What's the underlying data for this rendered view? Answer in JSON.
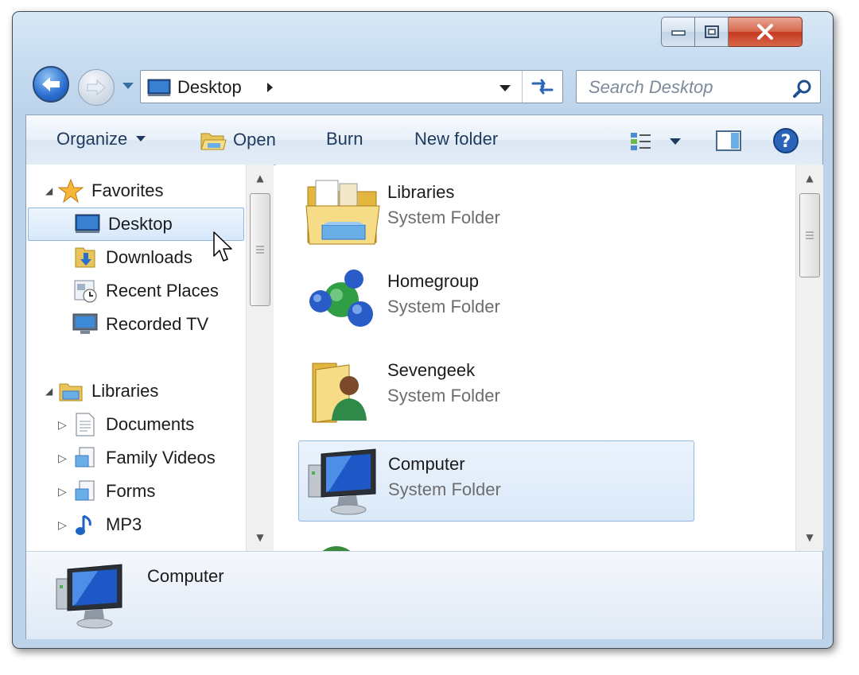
{
  "window": {
    "caption_buttons": [
      "minimize",
      "maximize",
      "close"
    ]
  },
  "address_bar": {
    "location": "Desktop"
  },
  "search": {
    "placeholder": "Search Desktop"
  },
  "toolbar": {
    "organize": "Organize",
    "open": "Open",
    "burn": "Burn",
    "new_folder": "New folder"
  },
  "navigation": {
    "favorites_header": "Favorites",
    "favorites": [
      {
        "label": "Desktop",
        "icon": "desktop-icon",
        "selected": true
      },
      {
        "label": "Downloads",
        "icon": "downloads-icon",
        "selected": false
      },
      {
        "label": "Recent Places",
        "icon": "recent-places-icon",
        "selected": false
      },
      {
        "label": "Recorded TV",
        "icon": "recorded-tv-icon",
        "selected": false
      }
    ],
    "libraries_header": "Libraries",
    "libraries": [
      {
        "label": "Documents",
        "icon": "documents-icon"
      },
      {
        "label": "Family Videos",
        "icon": "library-icon"
      },
      {
        "label": "Forms",
        "icon": "library-icon"
      },
      {
        "label": "MP3",
        "icon": "music-icon"
      }
    ]
  },
  "content": {
    "items": [
      {
        "name": "Libraries",
        "type": "System Folder",
        "icon": "libraries-icon",
        "selected": false
      },
      {
        "name": "Homegroup",
        "type": "System Folder",
        "icon": "homegroup-icon",
        "selected": false
      },
      {
        "name": "Sevengeek",
        "type": "System Folder",
        "icon": "user-folder-icon",
        "selected": false
      },
      {
        "name": "Computer",
        "type": "System Folder",
        "icon": "computer-icon",
        "selected": true
      }
    ]
  },
  "details": {
    "name": "Computer"
  },
  "colors": {
    "selection": "#d6e8fa",
    "window_frame": "#c5dbf0",
    "close_button": "#c4391e"
  }
}
